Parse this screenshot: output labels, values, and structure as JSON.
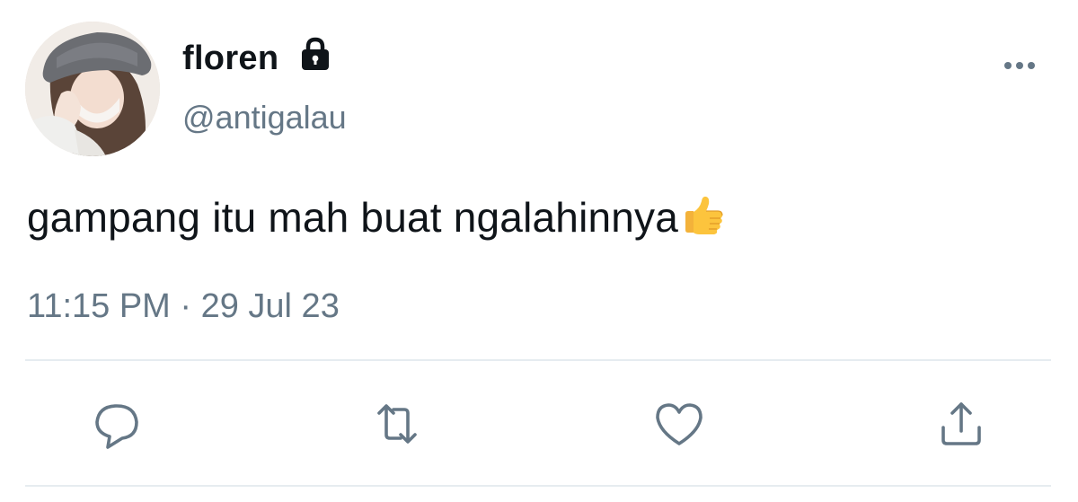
{
  "user": {
    "display_name": "floren",
    "handle": "@antigalau",
    "protected_icon": "lock-icon"
  },
  "tweet": {
    "text": "gampang itu mah buat ngalahinnya",
    "emoji_icon": "thumbs-up-emoji",
    "timestamp": "11:15 PM · 29 Jul 23"
  },
  "actions": {
    "reply_icon": "speech-bubble-icon",
    "retweet_icon": "retweet-icon",
    "like_icon": "heart-icon",
    "share_icon": "share-icon",
    "more_icon": "ellipsis-icon"
  },
  "colors": {
    "text": "#0f1419",
    "secondary": "#657786",
    "divider": "#e6ecf0"
  }
}
